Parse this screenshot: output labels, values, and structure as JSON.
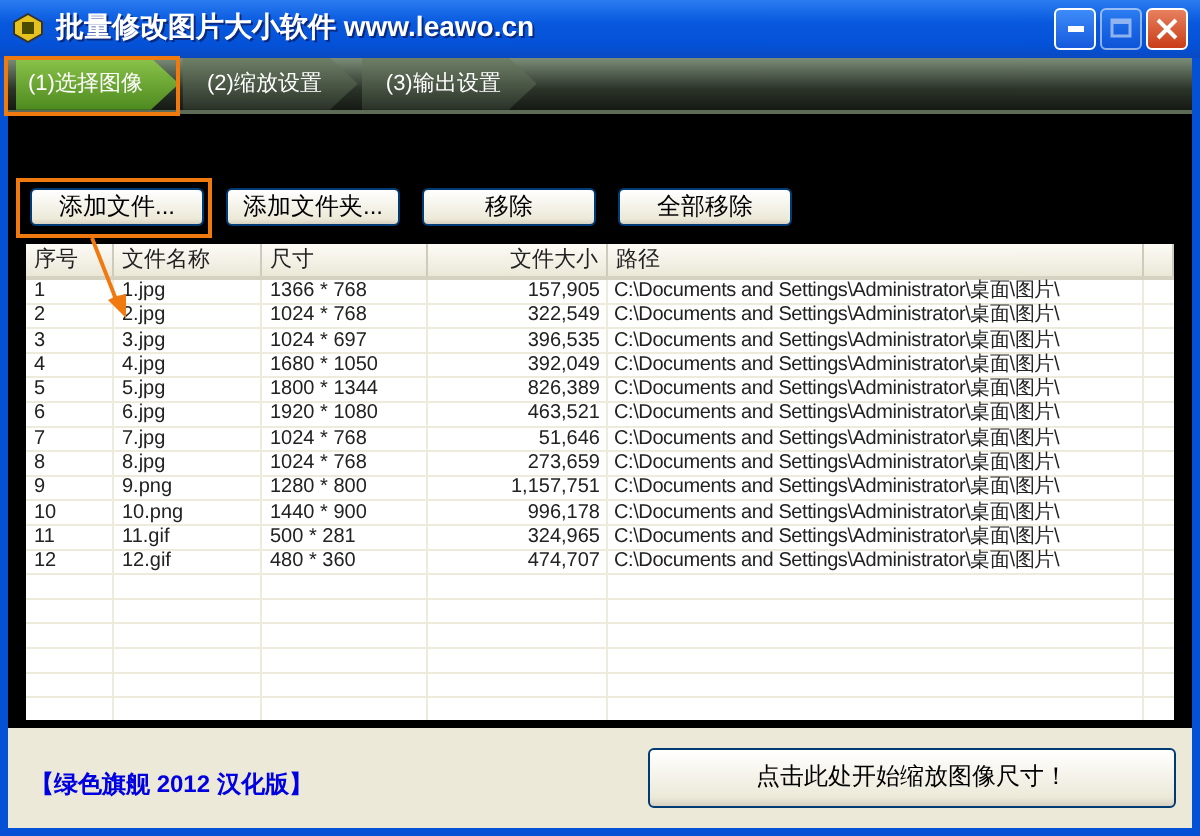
{
  "window": {
    "title": "批量修改图片大小软件 www.leawo.cn"
  },
  "steps": [
    {
      "label": "(1)选择图像",
      "selected": true
    },
    {
      "label": "(2)缩放设置",
      "selected": false
    },
    {
      "label": "(3)输出设置",
      "selected": false
    }
  ],
  "toolbar": {
    "buttons": [
      "添加文件...",
      "添加文件夹...",
      "移除",
      "全部移除"
    ]
  },
  "table": {
    "columns": [
      "序号",
      "文件名称",
      "尺寸",
      "文件大小",
      "路径"
    ],
    "rows": [
      [
        "1",
        "1.jpg",
        "1366 * 768",
        "157,905",
        "C:\\Documents and Settings\\Administrator\\桌面\\图片\\"
      ],
      [
        "2",
        "2.jpg",
        "1024 * 768",
        "322,549",
        "C:\\Documents and Settings\\Administrator\\桌面\\图片\\"
      ],
      [
        "3",
        "3.jpg",
        "1024 * 697",
        "396,535",
        "C:\\Documents and Settings\\Administrator\\桌面\\图片\\"
      ],
      [
        "4",
        "4.jpg",
        "1680 * 1050",
        "392,049",
        "C:\\Documents and Settings\\Administrator\\桌面\\图片\\"
      ],
      [
        "5",
        "5.jpg",
        "1800 * 1344",
        "826,389",
        "C:\\Documents and Settings\\Administrator\\桌面\\图片\\"
      ],
      [
        "6",
        "6.jpg",
        "1920 * 1080",
        "463,521",
        "C:\\Documents and Settings\\Administrator\\桌面\\图片\\"
      ],
      [
        "7",
        "7.jpg",
        "1024 * 768",
        "51,646",
        "C:\\Documents and Settings\\Administrator\\桌面\\图片\\"
      ],
      [
        "8",
        "8.jpg",
        "1024 * 768",
        "273,659",
        "C:\\Documents and Settings\\Administrator\\桌面\\图片\\"
      ],
      [
        "9",
        "9.png",
        "1280 * 800",
        "1,157,751",
        "C:\\Documents and Settings\\Administrator\\桌面\\图片\\"
      ],
      [
        "10",
        "10.png",
        "1440 * 900",
        "996,178",
        "C:\\Documents and Settings\\Administrator\\桌面\\图片\\"
      ],
      [
        "11",
        "11.gif",
        "500 * 281",
        "324,965",
        "C:\\Documents and Settings\\Administrator\\桌面\\图片\\"
      ],
      [
        "12",
        "12.gif",
        "480 * 360",
        "474,707",
        "C:\\Documents and Settings\\Administrator\\桌面\\图片\\"
      ]
    ]
  },
  "footer": {
    "edition": "【绿色旗舰 2012 汉化版】",
    "start_button": "点击此处开始缩放图像尺寸！"
  }
}
